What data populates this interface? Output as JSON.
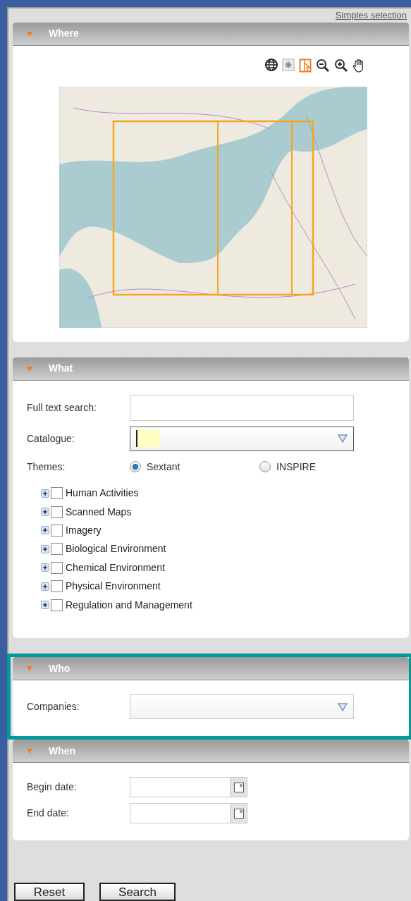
{
  "link": "Simples selection",
  "sections": [
    {
      "kind": "map",
      "title": "Where",
      "expanded": true,
      "highlighted": false
    },
    {
      "kind": "form",
      "title": "What",
      "expanded": true,
      "highlighted": false,
      "fields": [
        {
          "kind": "text",
          "label": "Full text search:",
          "focused": false
        },
        {
          "kind": "combo",
          "label": "Catalogue:",
          "focused": true
        }
      ],
      "themes": {
        "label": "Themes:",
        "options": [
          {
            "label": "Sextant",
            "selected": true
          },
          {
            "label": "INSPIRE",
            "selected": false
          }
        ],
        "items": [
          {
            "label": "Human Activities",
            "checked": false,
            "expanded": false
          },
          {
            "label": "Scanned Maps",
            "checked": false,
            "expanded": false
          },
          {
            "label": "Imagery",
            "checked": false,
            "expanded": false
          },
          {
            "label": "Biological Environment",
            "checked": false,
            "expanded": false
          },
          {
            "label": "Chemical Environment",
            "checked": false,
            "expanded": false
          },
          {
            "label": "Physical Environment",
            "checked": false,
            "expanded": false
          },
          {
            "label": "Regulation and Management",
            "checked": false,
            "expanded": false
          }
        ]
      }
    },
    {
      "kind": "form",
      "title": "Who",
      "expanded": true,
      "highlighted": true,
      "fields": [
        {
          "kind": "combo",
          "label": "Companies:",
          "focused": false
        }
      ]
    },
    {
      "kind": "form",
      "title": "When",
      "expanded": true,
      "highlighted": false,
      "fields": [
        {
          "kind": "date",
          "label": "Begin date:",
          "focused": false
        },
        {
          "kind": "date",
          "label": "End date:",
          "focused": false
        }
      ]
    }
  ],
  "buttons": [
    "Reset",
    "Search"
  ]
}
